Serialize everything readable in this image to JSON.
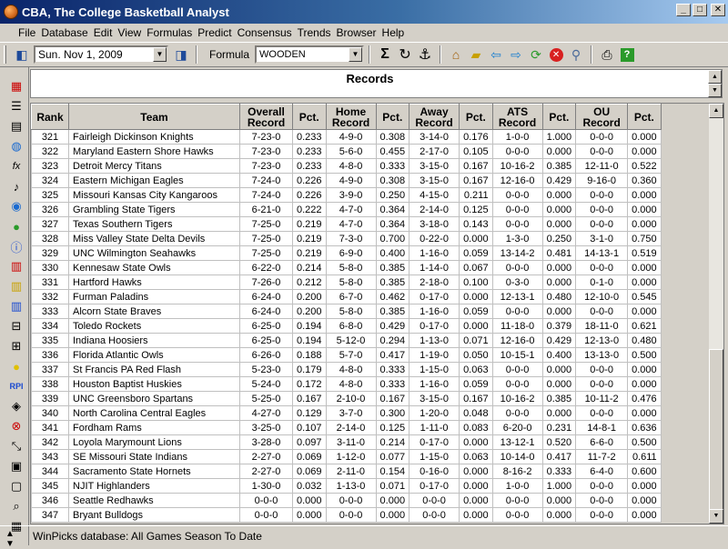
{
  "window": {
    "title": "CBA,  The College Basketball Analyst"
  },
  "menu": [
    "File",
    "Database",
    "Edit",
    "View",
    "Formulas",
    "Predict",
    "Consensus",
    "Trends",
    "Browser",
    "Help"
  ],
  "toolbar": {
    "date_value": "Sun. Nov  1, 2009",
    "formula_label": "Formula",
    "formula_value": "WOODEN"
  },
  "panel": {
    "title": "Records"
  },
  "columns": [
    {
      "line1": "Rank",
      "line2": ""
    },
    {
      "line1": "Team",
      "line2": ""
    },
    {
      "line1": "Overall",
      "line2": "Record"
    },
    {
      "line1": "Pct.",
      "line2": ""
    },
    {
      "line1": "Home",
      "line2": "Record"
    },
    {
      "line1": "Pct.",
      "line2": ""
    },
    {
      "line1": "Away",
      "line2": "Record"
    },
    {
      "line1": "Pct.",
      "line2": ""
    },
    {
      "line1": "ATS",
      "line2": "Record"
    },
    {
      "line1": "Pct.",
      "line2": ""
    },
    {
      "line1": "OU",
      "line2": "Record"
    },
    {
      "line1": "Pct.",
      "line2": ""
    }
  ],
  "rows": [
    [
      "321",
      "Fairleigh Dickinson Knights",
      "7-23-0",
      "0.233",
      "4-9-0",
      "0.308",
      "3-14-0",
      "0.176",
      "1-0-0",
      "1.000",
      "0-0-0",
      "0.000"
    ],
    [
      "322",
      "Maryland Eastern Shore Hawks",
      "7-23-0",
      "0.233",
      "5-6-0",
      "0.455",
      "2-17-0",
      "0.105",
      "0-0-0",
      "0.000",
      "0-0-0",
      "0.000"
    ],
    [
      "323",
      "Detroit Mercy Titans",
      "7-23-0",
      "0.233",
      "4-8-0",
      "0.333",
      "3-15-0",
      "0.167",
      "10-16-2",
      "0.385",
      "12-11-0",
      "0.522"
    ],
    [
      "324",
      "Eastern Michigan Eagles",
      "7-24-0",
      "0.226",
      "4-9-0",
      "0.308",
      "3-15-0",
      "0.167",
      "12-16-0",
      "0.429",
      "9-16-0",
      "0.360"
    ],
    [
      "325",
      "Missouri Kansas City Kangaroos",
      "7-24-0",
      "0.226",
      "3-9-0",
      "0.250",
      "4-15-0",
      "0.211",
      "0-0-0",
      "0.000",
      "0-0-0",
      "0.000"
    ],
    [
      "326",
      "Grambling State Tigers",
      "6-21-0",
      "0.222",
      "4-7-0",
      "0.364",
      "2-14-0",
      "0.125",
      "0-0-0",
      "0.000",
      "0-0-0",
      "0.000"
    ],
    [
      "327",
      "Texas Southern Tigers",
      "7-25-0",
      "0.219",
      "4-7-0",
      "0.364",
      "3-18-0",
      "0.143",
      "0-0-0",
      "0.000",
      "0-0-0",
      "0.000"
    ],
    [
      "328",
      "Miss Valley State Delta Devils",
      "7-25-0",
      "0.219",
      "7-3-0",
      "0.700",
      "0-22-0",
      "0.000",
      "1-3-0",
      "0.250",
      "3-1-0",
      "0.750"
    ],
    [
      "329",
      "UNC Wilmington Seahawks",
      "7-25-0",
      "0.219",
      "6-9-0",
      "0.400",
      "1-16-0",
      "0.059",
      "13-14-2",
      "0.481",
      "14-13-1",
      "0.519"
    ],
    [
      "330",
      "Kennesaw State Owls",
      "6-22-0",
      "0.214",
      "5-8-0",
      "0.385",
      "1-14-0",
      "0.067",
      "0-0-0",
      "0.000",
      "0-0-0",
      "0.000"
    ],
    [
      "331",
      "Hartford Hawks",
      "7-26-0",
      "0.212",
      "5-8-0",
      "0.385",
      "2-18-0",
      "0.100",
      "0-3-0",
      "0.000",
      "0-1-0",
      "0.000"
    ],
    [
      "332",
      "Furman Paladins",
      "6-24-0",
      "0.200",
      "6-7-0",
      "0.462",
      "0-17-0",
      "0.000",
      "12-13-1",
      "0.480",
      "12-10-0",
      "0.545"
    ],
    [
      "333",
      "Alcorn State Braves",
      "6-24-0",
      "0.200",
      "5-8-0",
      "0.385",
      "1-16-0",
      "0.059",
      "0-0-0",
      "0.000",
      "0-0-0",
      "0.000"
    ],
    [
      "334",
      "Toledo Rockets",
      "6-25-0",
      "0.194",
      "6-8-0",
      "0.429",
      "0-17-0",
      "0.000",
      "11-18-0",
      "0.379",
      "18-11-0",
      "0.621"
    ],
    [
      "335",
      "Indiana Hoosiers",
      "6-25-0",
      "0.194",
      "5-12-0",
      "0.294",
      "1-13-0",
      "0.071",
      "12-16-0",
      "0.429",
      "12-13-0",
      "0.480"
    ],
    [
      "336",
      "Florida Atlantic Owls",
      "6-26-0",
      "0.188",
      "5-7-0",
      "0.417",
      "1-19-0",
      "0.050",
      "10-15-1",
      "0.400",
      "13-13-0",
      "0.500"
    ],
    [
      "337",
      "St Francis PA Red Flash",
      "5-23-0",
      "0.179",
      "4-8-0",
      "0.333",
      "1-15-0",
      "0.063",
      "0-0-0",
      "0.000",
      "0-0-0",
      "0.000"
    ],
    [
      "338",
      "Houston Baptist Huskies",
      "5-24-0",
      "0.172",
      "4-8-0",
      "0.333",
      "1-16-0",
      "0.059",
      "0-0-0",
      "0.000",
      "0-0-0",
      "0.000"
    ],
    [
      "339",
      "UNC Greensboro Spartans",
      "5-25-0",
      "0.167",
      "2-10-0",
      "0.167",
      "3-15-0",
      "0.167",
      "10-16-2",
      "0.385",
      "10-11-2",
      "0.476"
    ],
    [
      "340",
      "North Carolina Central Eagles",
      "4-27-0",
      "0.129",
      "3-7-0",
      "0.300",
      "1-20-0",
      "0.048",
      "0-0-0",
      "0.000",
      "0-0-0",
      "0.000"
    ],
    [
      "341",
      "Fordham Rams",
      "3-25-0",
      "0.107",
      "2-14-0",
      "0.125",
      "1-11-0",
      "0.083",
      "6-20-0",
      "0.231",
      "14-8-1",
      "0.636"
    ],
    [
      "342",
      "Loyola Marymount Lions",
      "3-28-0",
      "0.097",
      "3-11-0",
      "0.214",
      "0-17-0",
      "0.000",
      "13-12-1",
      "0.520",
      "6-6-0",
      "0.500"
    ],
    [
      "343",
      "SE Missouri State Indians",
      "2-27-0",
      "0.069",
      "1-12-0",
      "0.077",
      "1-15-0",
      "0.063",
      "10-14-0",
      "0.417",
      "11-7-2",
      "0.611"
    ],
    [
      "344",
      "Sacramento State Hornets",
      "2-27-0",
      "0.069",
      "2-11-0",
      "0.154",
      "0-16-0",
      "0.000",
      "8-16-2",
      "0.333",
      "6-4-0",
      "0.600"
    ],
    [
      "345",
      "NJIT Highlanders",
      "1-30-0",
      "0.032",
      "1-13-0",
      "0.071",
      "0-17-0",
      "0.000",
      "1-0-0",
      "1.000",
      "0-0-0",
      "0.000"
    ],
    [
      "346",
      "Seattle Redhawks",
      "0-0-0",
      "0.000",
      "0-0-0",
      "0.000",
      "0-0-0",
      "0.000",
      "0-0-0",
      "0.000",
      "0-0-0",
      "0.000"
    ],
    [
      "347",
      "Bryant Bulldogs",
      "0-0-0",
      "0.000",
      "0-0-0",
      "0.000",
      "0-0-0",
      "0.000",
      "0-0-0",
      "0.000",
      "0-0-0",
      "0.000"
    ]
  ],
  "status": {
    "text": "WinPicks database:  All Games Season To Date"
  }
}
